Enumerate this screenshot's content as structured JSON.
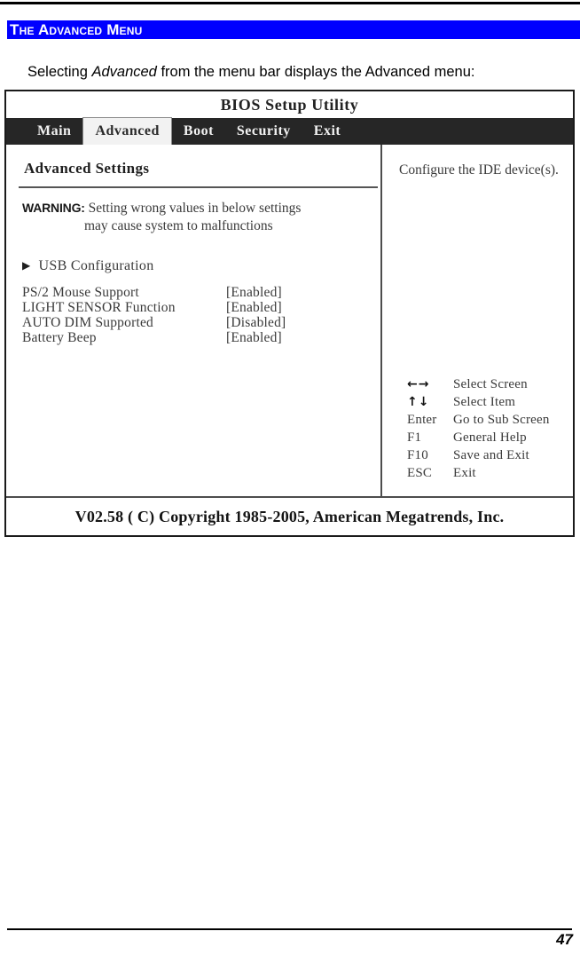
{
  "page": {
    "section_heading": "The Advanced Menu",
    "intro_before_italic": "Selecting ",
    "intro_italic": "Advanced",
    "intro_after_italic": " from the menu bar displays the Advanced menu:",
    "page_number": "47"
  },
  "bios": {
    "title": "BIOS Setup Utility",
    "tabs": [
      {
        "label": "Main",
        "selected": false
      },
      {
        "label": "Advanced",
        "selected": true
      },
      {
        "label": "Boot",
        "selected": false
      },
      {
        "label": "Security",
        "selected": false
      },
      {
        "label": "Exit",
        "selected": false
      }
    ],
    "left_pane": {
      "heading": "Advanced Settings",
      "warning_label": "WARNING:",
      "warning_line1": " Setting wrong values in below settings",
      "warning_line2": "may cause system to malfunctions",
      "submenu": {
        "arrow_icon": "▶",
        "label": "USB Configuration"
      },
      "settings": [
        {
          "name": "PS/2 Mouse Support",
          "value": "[Enabled]"
        },
        {
          "name": "LIGHT SENSOR Function",
          "value": "[Enabled]"
        },
        {
          "name": "AUTO DIM Supported",
          "value": "[Disabled]"
        },
        {
          "name": "Battery Beep",
          "value": "[Enabled]"
        }
      ]
    },
    "right_pane": {
      "help_text": "Configure the IDE device(s).",
      "key_legend": [
        {
          "key": "←→",
          "desc": "Select Screen",
          "is_arrow": true
        },
        {
          "key": "↑↓",
          "desc": "Select Item",
          "is_arrow": true
        },
        {
          "key": "Enter",
          "desc": "Go to Sub Screen",
          "is_arrow": false
        },
        {
          "key": "F1",
          "desc": "General Help",
          "is_arrow": false
        },
        {
          "key": "F10",
          "desc": "Save and Exit",
          "is_arrow": false
        },
        {
          "key": "ESC",
          "desc": "Exit",
          "is_arrow": false
        }
      ]
    },
    "footer": "V02.58  ( C) Copyright 1985-2005, American Megatrends, Inc."
  },
  "colors": {
    "heading_banner": "#0000ff",
    "heading_text": "#ffffff",
    "tabbar": "#262626",
    "selected_tab_bg": "#f2f2f2"
  }
}
